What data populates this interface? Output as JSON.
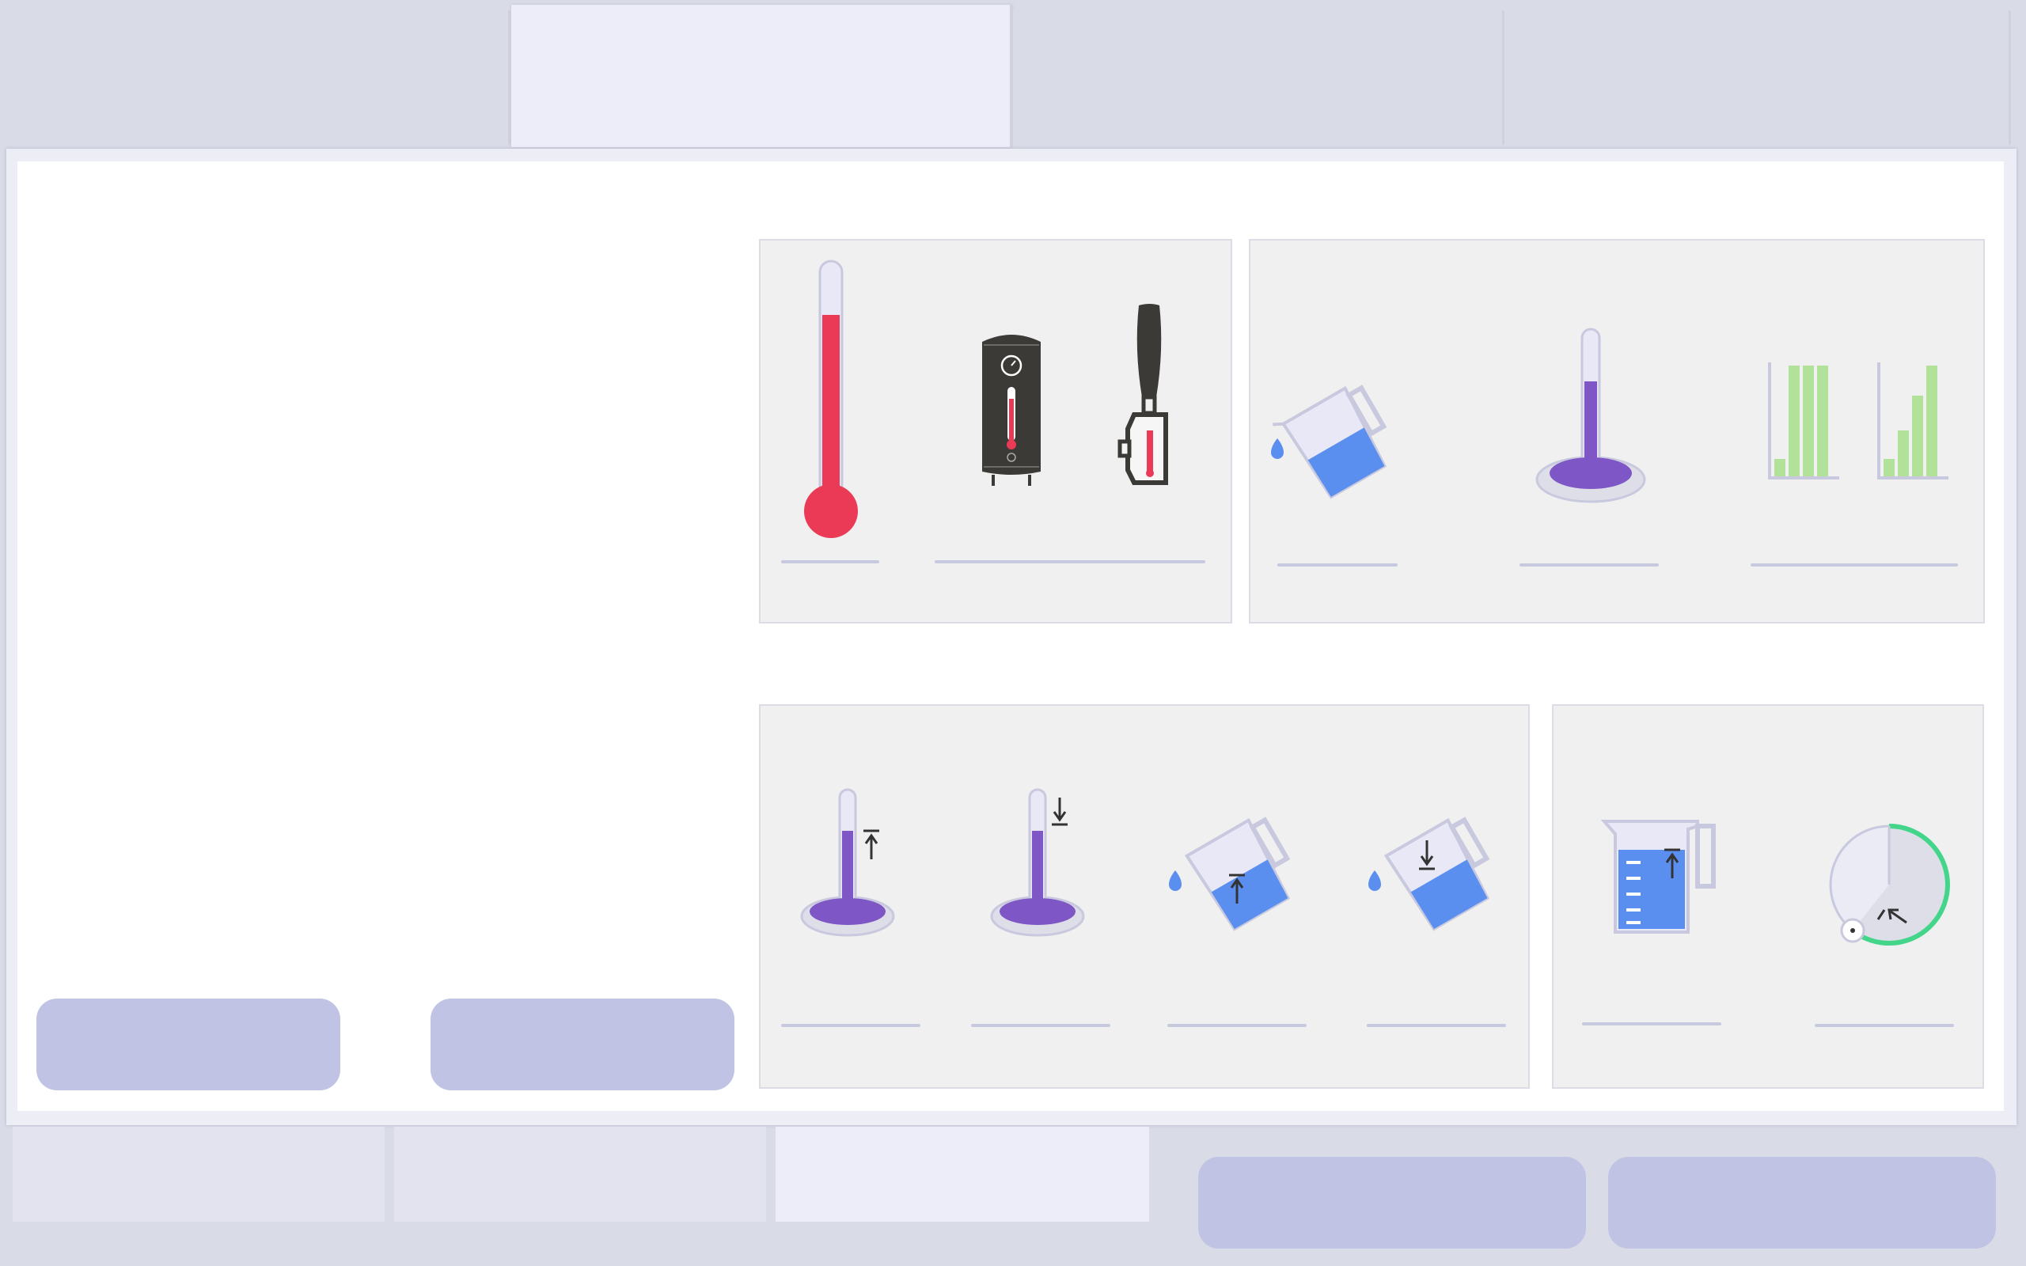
{
  "top_tabs": [
    {
      "label": ""
    },
    {
      "label": "",
      "active": true
    },
    {
      "label": ""
    },
    {
      "label": ""
    }
  ],
  "left_buttons": [
    {
      "label": ""
    },
    {
      "label": ""
    }
  ],
  "cards": {
    "temperature": {
      "items": [
        {
          "icon": "thermometer-icon",
          "caption": ""
        },
        {
          "icon": "water-heater-icon",
          "caption": ""
        },
        {
          "icon": "espresso-portafilter-thermometer-icon",
          "caption": ""
        }
      ]
    },
    "measurement": {
      "items": [
        {
          "icon": "pouring-jug-icon",
          "caption": ""
        },
        {
          "icon": "level-gauge-icon",
          "caption": ""
        },
        {
          "icon": "bar-levels-icon",
          "caption": ""
        }
      ]
    },
    "level_changes": {
      "items": [
        {
          "icon": "gauge-level-up-icon",
          "caption": ""
        },
        {
          "icon": "gauge-level-down-icon",
          "caption": ""
        },
        {
          "icon": "jug-level-up-icon",
          "caption": ""
        },
        {
          "icon": "jug-level-down-icon",
          "caption": ""
        }
      ]
    },
    "volume_time": {
      "items": [
        {
          "icon": "measuring-jug-up-icon",
          "caption": ""
        },
        {
          "icon": "timer-dial-icon",
          "caption": ""
        }
      ]
    }
  },
  "bottom_tabs": [
    {
      "label": ""
    },
    {
      "label": ""
    },
    {
      "label": "",
      "active": true
    }
  ],
  "bottom_buttons": [
    {
      "label": ""
    },
    {
      "label": ""
    }
  ],
  "colors": {
    "thermo_red": "#ea3a56",
    "purple": "#7e56c6",
    "blue": "#5a8ff0",
    "green_bar": "#b2e29a",
    "dial_green": "#43d68a",
    "dark": "#3b3a36",
    "pill": "#c0c3e3"
  }
}
